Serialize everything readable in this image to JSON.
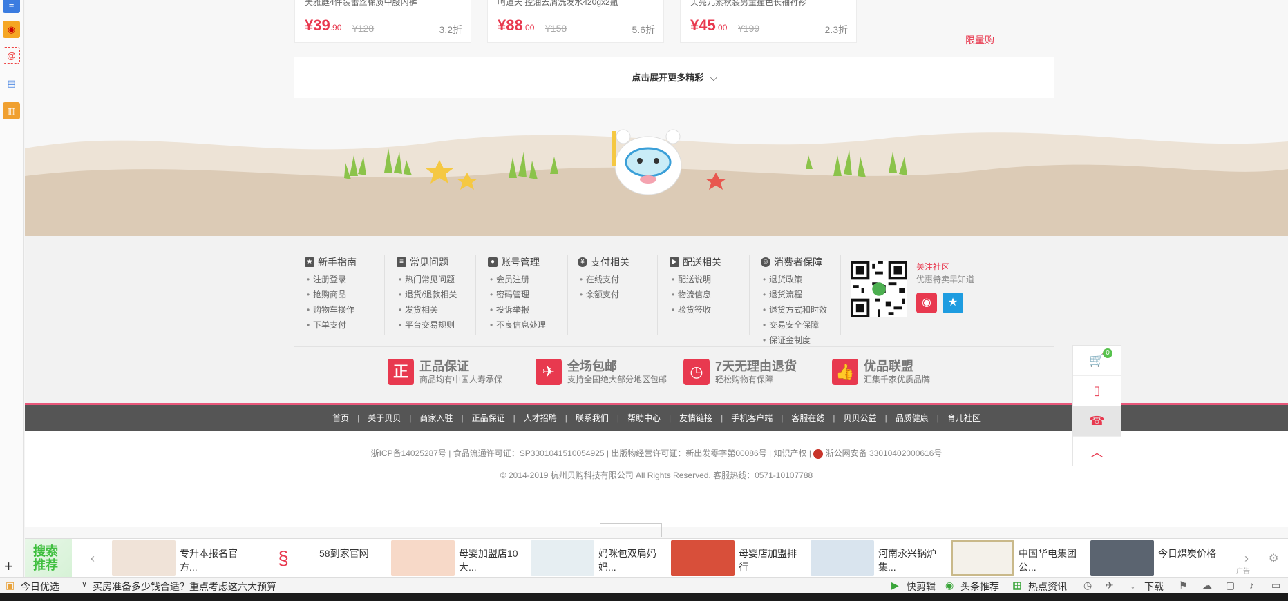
{
  "products": [
    {
      "name": "美雅庭4件装蕾丝棉质中腰内裤",
      "price_int": "¥39",
      "price_dec": ".90",
      "orig": "¥128",
      "discount": "3.2折"
    },
    {
      "name": "呵道夫 控油去屑洗发水420gx2瓶",
      "price_int": "¥88",
      "price_dec": ".00",
      "orig": "¥158",
      "discount": "5.6折"
    },
    {
      "name": "贝亮元素秋装男童撞色长袖衬衫",
      "price_int": "¥45",
      "price_dec": ".00",
      "orig": "¥199",
      "discount": "2.3折"
    }
  ],
  "limit_buy": "限量购",
  "expand_label": "点击展开更多精彩",
  "help": [
    {
      "title": "新手指南",
      "icon": "★",
      "items": [
        "注册登录",
        "抢购商品",
        "购物车操作",
        "下单支付"
      ]
    },
    {
      "title": "常见问题",
      "icon": "≡",
      "items": [
        "热门常见问题",
        "退货/退款相关",
        "发货相关",
        "平台交易规则"
      ]
    },
    {
      "title": "账号管理",
      "icon": "●",
      "items": [
        "会员注册",
        "密码管理",
        "投诉举报",
        "不良信息处理"
      ]
    },
    {
      "title": "支付相关",
      "icon": "¥",
      "items": [
        "在线支付",
        "余额支付"
      ]
    },
    {
      "title": "配送相关",
      "icon": "▶",
      "items": [
        "配送说明",
        "物流信息",
        "验货签收"
      ]
    },
    {
      "title": "消费者保障",
      "icon": "☺",
      "items": [
        "退货政策",
        "退货流程",
        "退货方式和时效",
        "交易安全保障",
        "保证金制度"
      ]
    }
  ],
  "follow": {
    "title": "关注社区",
    "subtitle": "优惠特卖早知道"
  },
  "guarantees": [
    {
      "icon": "正",
      "title": "正品保证",
      "sub": "商品均有中国人寿承保"
    },
    {
      "icon": "✈",
      "title": "全场包邮",
      "sub": "支持全国绝大部分地区包邮"
    },
    {
      "icon": "◷",
      "title": "7天无理由退货",
      "sub": "轻松购物有保障"
    },
    {
      "icon": "👍",
      "title": "优品联盟",
      "sub": "汇集千家优质品牌"
    }
  ],
  "nav": [
    "首页",
    "关于贝贝",
    "商家入驻",
    "正品保证",
    "人才招聘",
    "联系我们",
    "帮助中心",
    "友情链接",
    "手机客户端",
    "客服在线",
    "贝贝公益",
    "品质健康",
    "育儿社区"
  ],
  "legal": {
    "line1": "浙ICP备14025287号 | 食品流通许可证：SP3301041510054925 | 出版物经营许可证：新出发零字第00086号 | 知识产权 |",
    "police": "浙公网安备 33010402000616号",
    "line2": "© 2014-2019 杭州贝购科技有限公司 All Rights Reserved. 客服热线：0571-10107788"
  },
  "cart_count": "0",
  "ad": {
    "search_label": [
      "搜索",
      "推荐"
    ],
    "items": [
      {
        "text": "专升本报名官方...",
        "color": "#f0e3d8"
      },
      {
        "text": "58到家官网",
        "color": "#ffffff"
      },
      {
        "text": "母婴加盟店10大...",
        "color": "#f7d9c8"
      },
      {
        "text": "妈咪包双肩妈妈...",
        "color": "#e6eef2"
      },
      {
        "text": "母婴店加盟排行",
        "color": "#d84f3a"
      },
      {
        "text": "河南永兴锅炉集...",
        "color": "#d9e4ee"
      },
      {
        "text": "中国华电集团公...",
        "color": "#f4f1ea"
      },
      {
        "text": "今日煤炭价格",
        "color": "#5b6470"
      }
    ],
    "tag": "广告"
  },
  "status": {
    "today": "今日优选",
    "headline": "买房准备多少钱合适？重点考虑这六大预算",
    "right": [
      "快剪辑",
      "头条推荐",
      "热点资讯",
      "下载"
    ]
  }
}
